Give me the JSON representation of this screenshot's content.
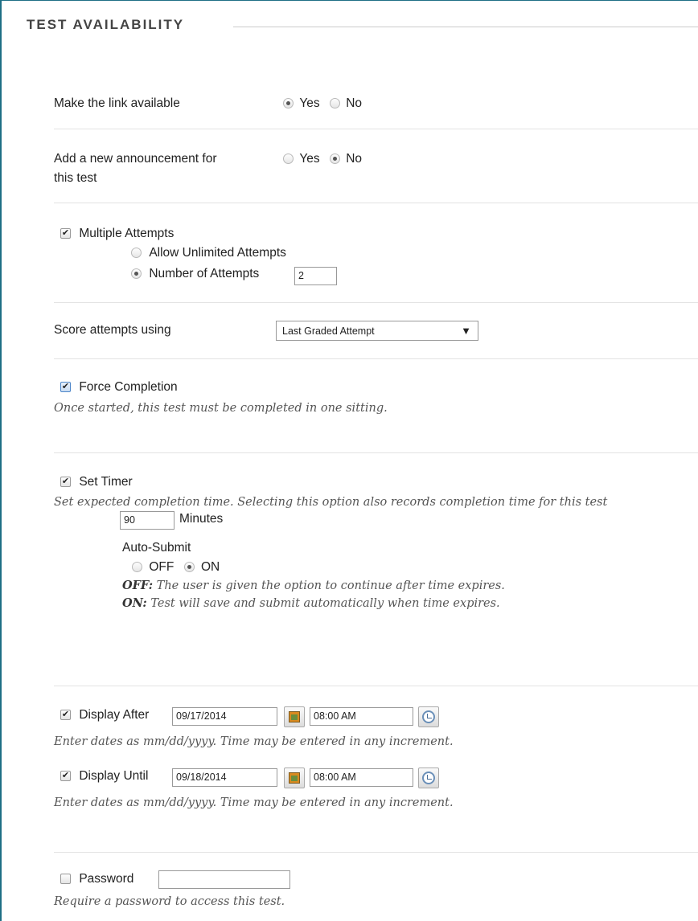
{
  "section": {
    "title": "TEST AVAILABILITY"
  },
  "make_link": {
    "label": "Make the link available",
    "yes": "Yes",
    "no": "No"
  },
  "announcement": {
    "label_line1": "Add a new announcement for",
    "label_line2": "this test",
    "yes": "Yes",
    "no": "No"
  },
  "attempts": {
    "label": "Multiple Attempts",
    "unlimited": "Allow Unlimited Attempts",
    "number": "Number of Attempts",
    "number_value": "2"
  },
  "score": {
    "label": "Score attempts using",
    "selected": "Last Graded Attempt",
    "arrow": "▼"
  },
  "force": {
    "label": "Force Completion",
    "help": "Once started, this test must be completed in one sitting."
  },
  "timer": {
    "label": "Set Timer",
    "help": "Set expected completion time. Selecting this option also records completion time for this test",
    "minutes_value": "90",
    "minutes_label": "Minutes",
    "auto_submit": "Auto-Submit",
    "off": "OFF",
    "on": "ON",
    "off_desc_key": "OFF:",
    "off_desc": " The user is given the option to continue after time expires.",
    "on_desc_key": "ON:",
    "on_desc": " Test will save and submit automatically when time expires."
  },
  "display_after": {
    "label": "Display After",
    "date": "09/17/2014",
    "time": "08:00 AM",
    "help": "Enter dates as mm/dd/yyyy. Time may be entered in any increment."
  },
  "display_until": {
    "label": "Display Until",
    "date": "09/18/2014",
    "time": "08:00 AM",
    "help": "Enter dates as mm/dd/yyyy. Time may be entered in any increment."
  },
  "password": {
    "label": "Password",
    "value": "",
    "help": "Require a password to access this test."
  },
  "icons": {
    "check": "✔",
    "calendar": "calendar-icon",
    "clock": "clock-icon"
  }
}
